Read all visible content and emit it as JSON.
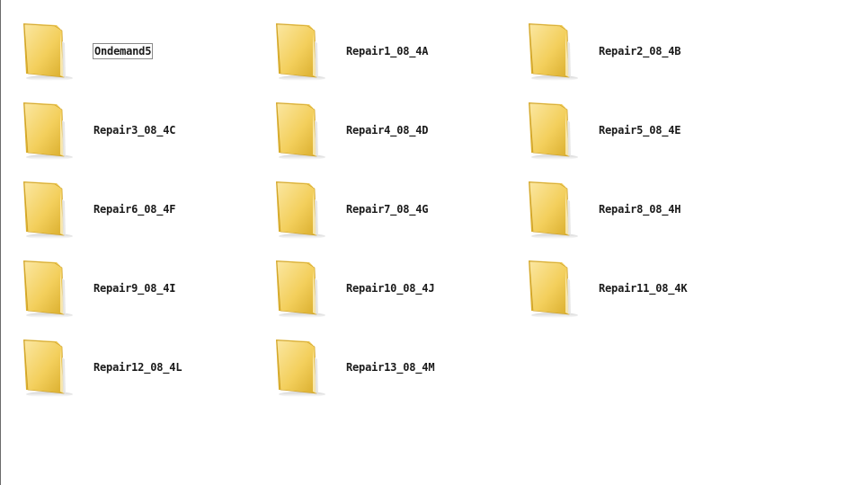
{
  "folders": [
    {
      "name": "Ondemand5",
      "renaming": true
    },
    {
      "name": "Repair1_08_4A"
    },
    {
      "name": "Repair2_08_4B"
    },
    {
      "name": "Repair3_08_4C"
    },
    {
      "name": "Repair4_08_4D"
    },
    {
      "name": "Repair5_08_4E"
    },
    {
      "name": "Repair6_08_4F"
    },
    {
      "name": "Repair7_08_4G"
    },
    {
      "name": "Repair8_08_4H"
    },
    {
      "name": "Repair9_08_4I"
    },
    {
      "name": "Repair10_08_4J"
    },
    {
      "name": "Repair11_08_4K"
    },
    {
      "name": "Repair12_08_4L"
    },
    {
      "name": "Repair13_08_4M"
    }
  ],
  "icons": {
    "folder": "folder-icon"
  },
  "colors": {
    "folder_light": "#fbe7a1",
    "folder_mid": "#f3cf5c",
    "folder_dark": "#d9ad2c",
    "background": "#ffffff"
  }
}
